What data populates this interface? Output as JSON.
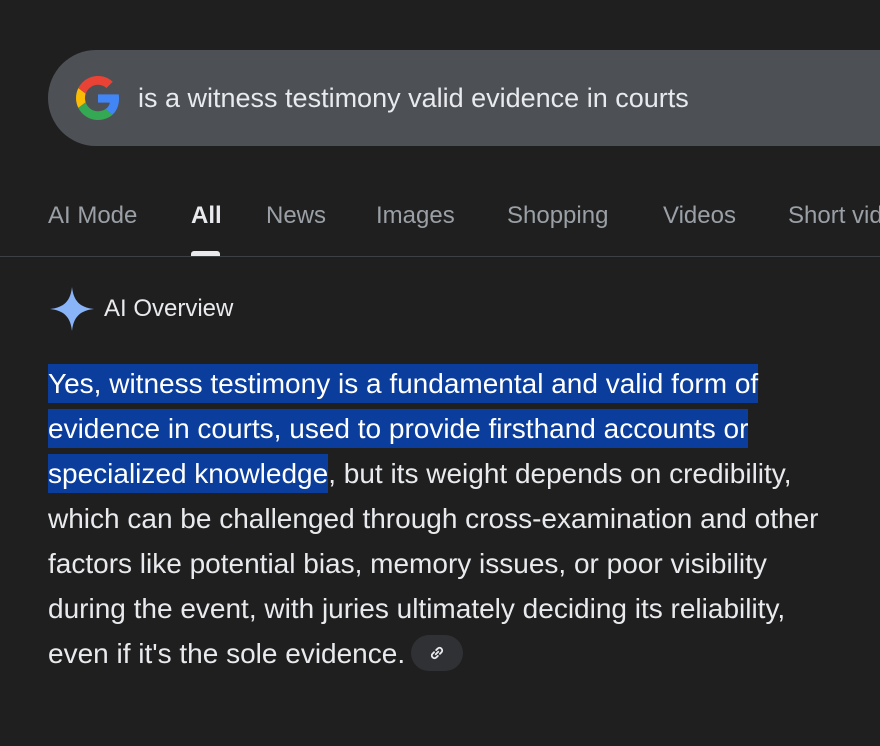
{
  "search": {
    "query": "is a witness testimony valid evidence in courts"
  },
  "tabs": [
    {
      "label": "AI Mode",
      "active": false
    },
    {
      "label": "All",
      "active": true
    },
    {
      "label": "News",
      "active": false
    },
    {
      "label": "Images",
      "active": false
    },
    {
      "label": "Shopping",
      "active": false
    },
    {
      "label": "Videos",
      "active": false
    },
    {
      "label": "Short videos",
      "active": false
    }
  ],
  "ai_overview": {
    "title": "AI Overview",
    "icon": "sparkle-icon",
    "highlighted_text": "Yes, witness testimony is a fundamental and valid form of evidence in courts, used to provide firsthand accounts or specialized knowledge",
    "rest_text": ", but its weight depends on credibility, which can be challenged through cross-examination and other factors like potential bias, memory issues, or poor visibility during the event, with juries ultimately deciding its reliability, even if it's the sole evidence.",
    "link_icon": "link-icon"
  },
  "colors": {
    "background": "#1f1f1f",
    "search_bar": "#4d5156",
    "highlight": "#0b3d9c",
    "tab_inactive": "#9aa0a6",
    "text": "#e8eaed",
    "sparkle": "#8ab4f8"
  }
}
